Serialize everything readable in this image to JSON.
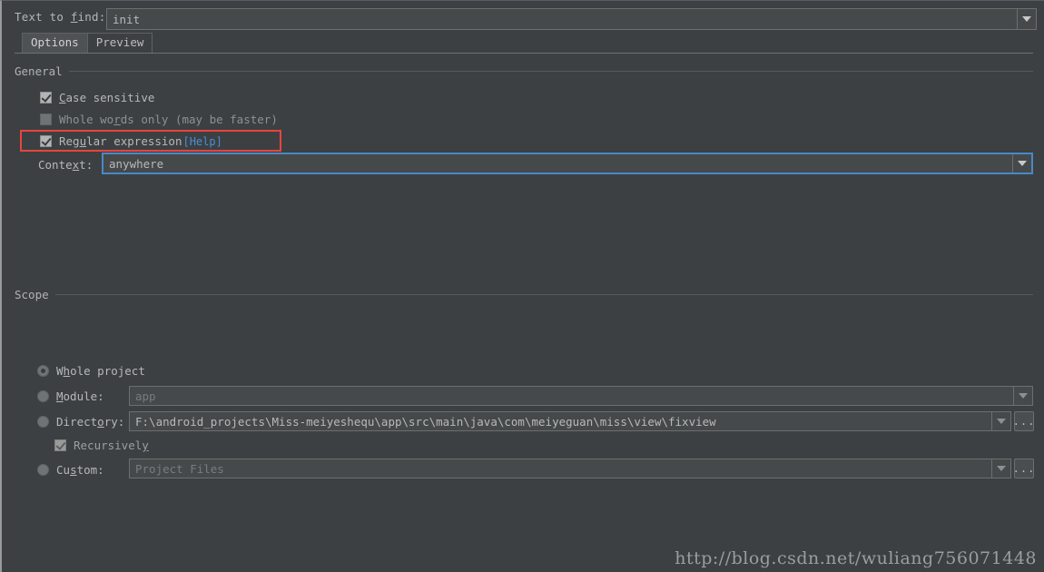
{
  "colors": {
    "background": "#3c4043",
    "field_background": "#45494a",
    "border": "#6b6f71",
    "text": "#b8b8b8",
    "accent_focus": "#4a88c7",
    "link": "#4a8fd4",
    "highlight_red": "#e8453c",
    "disabled_text": "#8d9193"
  },
  "find": {
    "label_prefix": "Text to ",
    "label_mnemonic": "f",
    "label_suffix": "ind:",
    "value": "init",
    "dropdown_icon": "chevron-down-icon"
  },
  "tabs": [
    {
      "label": "Options",
      "active": true
    },
    {
      "label": "Preview",
      "active": false
    }
  ],
  "general": {
    "title": "General",
    "options": [
      {
        "id": "case-sensitive",
        "prefix": "",
        "mnemonic": "C",
        "suffix": "ase sensitive",
        "checked": true,
        "enabled": true
      },
      {
        "id": "whole-words-only",
        "prefix": "Whole wo",
        "mnemonic": "r",
        "suffix": "ds only (may be faster)",
        "checked": false,
        "enabled": false
      },
      {
        "id": "regular-expression",
        "prefix": "Reg",
        "mnemonic": "u",
        "suffix": "lar expression",
        "checked": true,
        "enabled": true,
        "link": "[Help]",
        "highlighted": true
      }
    ],
    "context": {
      "label_prefix": "Conte",
      "label_mnemonic": "x",
      "label_suffix": "t:",
      "value": "anywhere",
      "focused": true,
      "dropdown_icon": "chevron-down-icon"
    }
  },
  "scope": {
    "title": "Scope",
    "selected": "whole-project",
    "items": [
      {
        "id": "whole-project",
        "prefix": "W",
        "mnemonic": "h",
        "suffix": "ole project",
        "selected": true,
        "has_field": false
      },
      {
        "id": "module",
        "prefix": "",
        "mnemonic": "M",
        "suffix": "odule:",
        "selected": false,
        "has_field": true,
        "field_value": "app",
        "field_is_placeholder": true,
        "has_browse": false,
        "dropdown_icon": "chevron-down-icon"
      },
      {
        "id": "directory",
        "prefix": "Direct",
        "mnemonic": "o",
        "suffix": "ry:",
        "selected": false,
        "has_field": true,
        "field_value": "F:\\android_projects\\Miss-meiyeshequ\\app\\src\\main\\java\\com\\meiyeguan\\miss\\view\\fixview",
        "field_is_placeholder": false,
        "has_browse": true,
        "browse_label": "...",
        "dropdown_icon": "chevron-down-icon"
      },
      {
        "id": "custom",
        "prefix": "Cu",
        "mnemonic": "s",
        "suffix": "tom:",
        "selected": false,
        "has_field": true,
        "field_value": "Project Files",
        "field_is_placeholder": true,
        "has_browse": true,
        "browse_label": "...",
        "dropdown_icon": "chevron-down-icon"
      }
    ],
    "recursively": {
      "prefix": "Recursivel",
      "mnemonic": "y",
      "suffix": "",
      "checked": true,
      "enabled": false
    }
  },
  "watermark": "http://blog.csdn.net/wuliang756071448"
}
